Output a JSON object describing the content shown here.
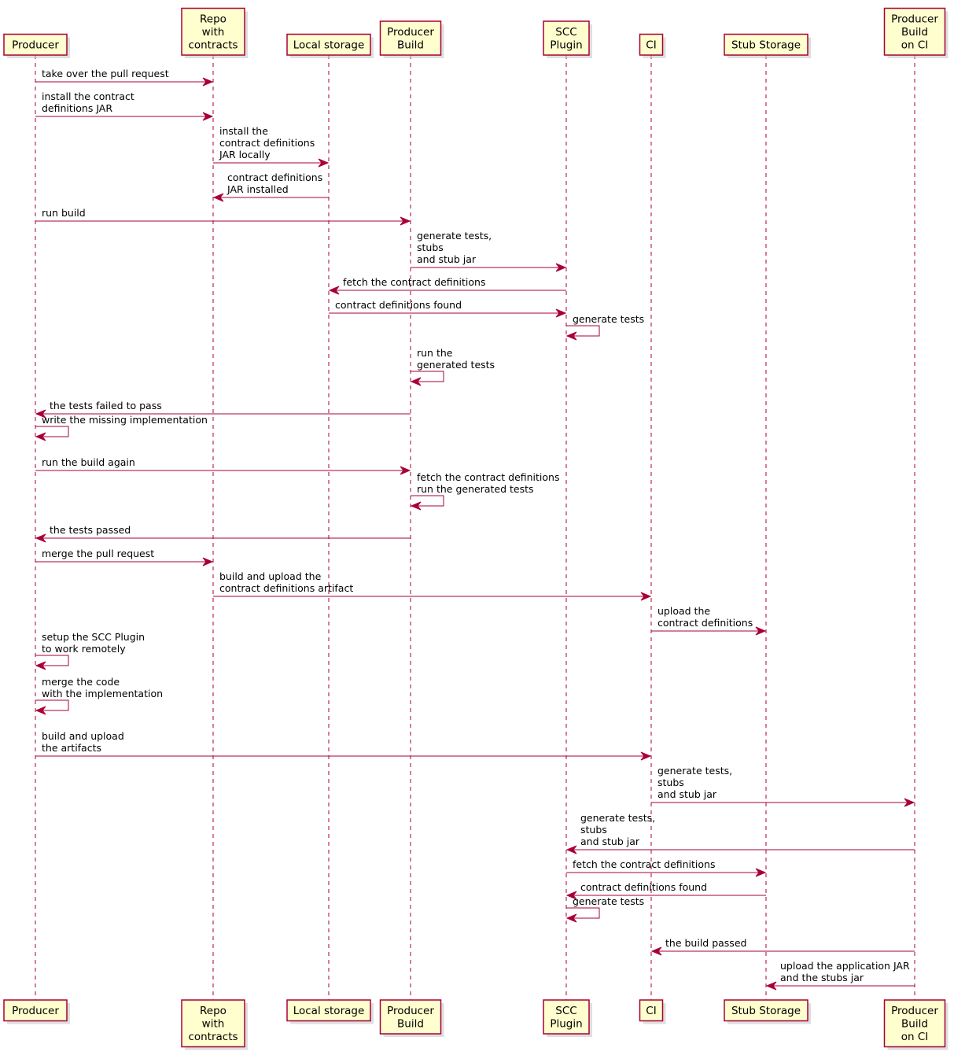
{
  "diagram": {
    "type": "sequence",
    "colors": {
      "participant_fill": "#FEFECE",
      "participant_border": "#A80036",
      "lifeline": "#A80036",
      "arrow": "#A80036",
      "text": "#000000",
      "shadow": "#C8C8C8"
    },
    "participants": [
      {
        "id": "producer",
        "lines": [
          "Producer"
        ]
      },
      {
        "id": "repo",
        "lines": [
          "Repo",
          "with",
          "contracts"
        ]
      },
      {
        "id": "local",
        "lines": [
          "Local storage"
        ]
      },
      {
        "id": "pbuild",
        "lines": [
          "Producer",
          "Build"
        ]
      },
      {
        "id": "scc",
        "lines": [
          "SCC",
          "Plugin"
        ]
      },
      {
        "id": "ci",
        "lines": [
          "CI"
        ]
      },
      {
        "id": "stub",
        "lines": [
          "Stub Storage"
        ]
      },
      {
        "id": "pbci",
        "lines": [
          "Producer",
          "Build",
          "on CI"
        ]
      }
    ],
    "messages": [
      {
        "from": "producer",
        "to": "repo",
        "lines": [
          "take over the pull request"
        ]
      },
      {
        "from": "producer",
        "to": "repo",
        "lines": [
          "install the contract",
          "definitions JAR"
        ]
      },
      {
        "from": "repo",
        "to": "local",
        "lines": [
          "install the",
          "contract definitions",
          "JAR locally"
        ]
      },
      {
        "from": "local",
        "to": "repo",
        "lines": [
          "contract definitions",
          "JAR installed"
        ]
      },
      {
        "from": "producer",
        "to": "pbuild",
        "lines": [
          "run build"
        ]
      },
      {
        "from": "pbuild",
        "to": "scc",
        "lines": [
          "generate tests,",
          "stubs",
          "and stub jar"
        ]
      },
      {
        "from": "scc",
        "to": "local",
        "lines": [
          "fetch the contract definitions"
        ]
      },
      {
        "from": "local",
        "to": "scc",
        "lines": [
          "contract definitions found"
        ]
      },
      {
        "from": "scc",
        "to": "scc",
        "lines": [
          "generate tests"
        ]
      },
      {
        "from": "pbuild",
        "to": "pbuild",
        "lines": [
          "run the",
          "generated tests"
        ]
      },
      {
        "from": "pbuild",
        "to": "producer",
        "lines": [
          "the tests failed to pass"
        ]
      },
      {
        "from": "producer",
        "to": "producer",
        "lines": [
          "write the missing implementation"
        ]
      },
      {
        "from": "producer",
        "to": "pbuild",
        "lines": [
          "run the build again"
        ]
      },
      {
        "from": "pbuild",
        "to": "pbuild",
        "lines": [
          "fetch the contract definitions",
          "run the generated tests"
        ]
      },
      {
        "from": "pbuild",
        "to": "producer",
        "lines": [
          "the tests passed"
        ]
      },
      {
        "from": "producer",
        "to": "repo",
        "lines": [
          "merge the pull request"
        ]
      },
      {
        "from": "repo",
        "to": "ci",
        "lines": [
          "build and upload the",
          "contract definitions artifact"
        ]
      },
      {
        "from": "ci",
        "to": "stub",
        "lines": [
          "upload the",
          "contract definitions"
        ]
      },
      {
        "from": "producer",
        "to": "producer",
        "lines": [
          "setup the SCC Plugin",
          "to work remotely"
        ]
      },
      {
        "from": "producer",
        "to": "producer",
        "lines": [
          "merge the code",
          "with the implementation"
        ]
      },
      {
        "from": "producer",
        "to": "ci",
        "lines": [
          "build and upload",
          "the artifacts"
        ]
      },
      {
        "from": "ci",
        "to": "pbci",
        "lines": [
          "generate tests,",
          "stubs",
          "and stub jar"
        ]
      },
      {
        "from": "pbci",
        "to": "scc",
        "lines": [
          "generate tests,",
          "stubs",
          "and stub jar"
        ]
      },
      {
        "from": "scc",
        "to": "stub",
        "lines": [
          "fetch the contract definitions"
        ]
      },
      {
        "from": "stub",
        "to": "scc",
        "lines": [
          "contract definitions found"
        ]
      },
      {
        "from": "scc",
        "to": "scc",
        "lines": [
          "generate tests"
        ]
      },
      {
        "from": "pbci",
        "to": "ci",
        "lines": [
          "the build passed"
        ]
      },
      {
        "from": "pbci",
        "to": "stub",
        "lines": [
          "upload the application JAR",
          "and the stubs jar"
        ]
      }
    ]
  }
}
